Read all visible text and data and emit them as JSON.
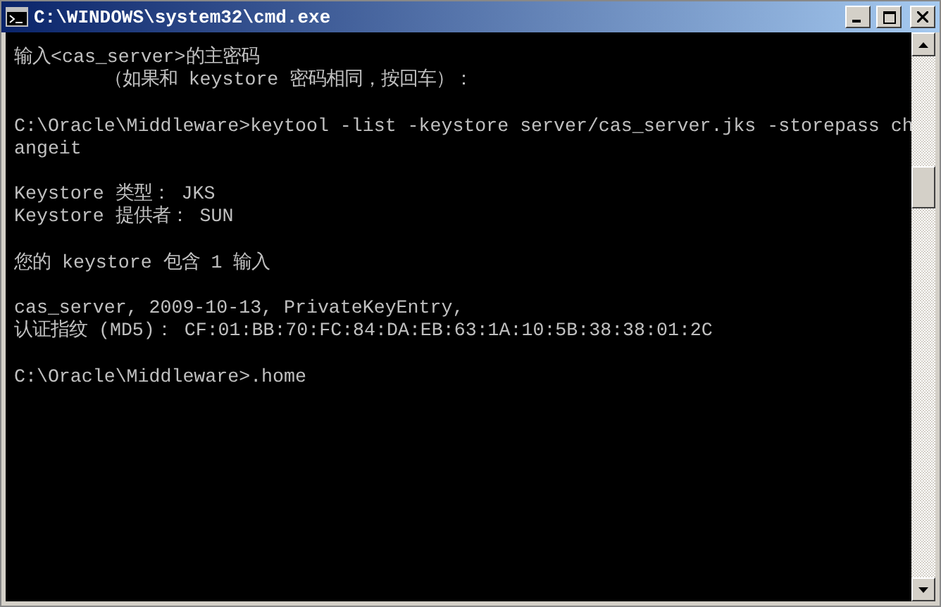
{
  "window": {
    "title": "C:\\WINDOWS\\system32\\cmd.exe"
  },
  "console_blocks": [
    [
      "输入<cas_server>的主密码",
      "        （如果和 keystore 密码相同，按回车）："
    ],
    [
      "C:\\Oracle\\Middleware>keytool -list -keystore server/cas_server.jks -storepass ch",
      "angeit"
    ],
    [
      "Keystore 类型： JKS",
      "Keystore 提供者： SUN"
    ],
    [
      "您的 keystore 包含 1 输入"
    ],
    [
      "cas_server, 2009-10-13, PrivateKeyEntry,",
      "认证指纹 (MD5)： CF:01:BB:70:FC:84:DA:EB:63:1A:10:5B:38:38:01:2C"
    ],
    [
      "C:\\Oracle\\Middleware>.home"
    ]
  ]
}
